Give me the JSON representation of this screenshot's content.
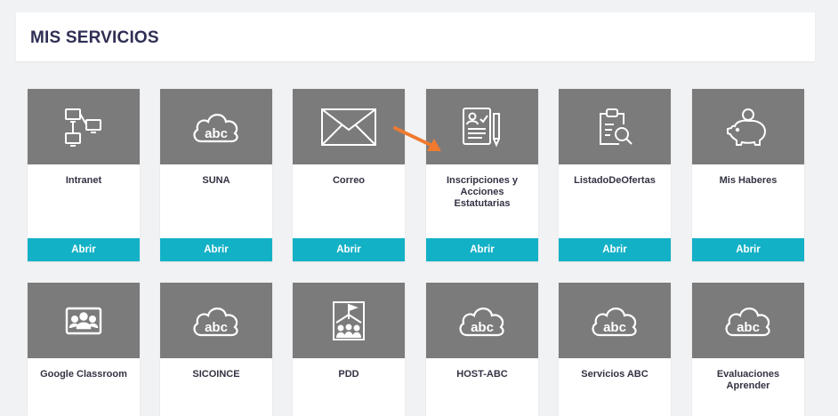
{
  "header": {
    "title": "MIS SERVICIOS"
  },
  "colors": {
    "accent": "#13b1c6",
    "tile": "#7b7b7b",
    "arrow": "#ef7a2e"
  },
  "cards": [
    {
      "label": "Intranet",
      "icon": "network-computers-icon",
      "button": "Abrir"
    },
    {
      "label": "SUNA",
      "icon": "abc-cloud-icon",
      "button": "Abrir"
    },
    {
      "label": "Correo",
      "icon": "envelope-icon",
      "button": "Abrir"
    },
    {
      "label": "Inscripciones y\nAcciones Estatutarias",
      "icon": "document-pen-icon",
      "button": "Abrir"
    },
    {
      "label": "ListadoDeOfertas",
      "icon": "clipboard-search-icon",
      "button": "Abrir"
    },
    {
      "label": "Mis Haberes",
      "icon": "piggy-bank-icon",
      "button": "Abrir"
    },
    {
      "label": "Google Classroom",
      "icon": "classroom-board-icon"
    },
    {
      "label": "SICOINCE",
      "icon": "abc-cloud-icon"
    },
    {
      "label": "PDD",
      "icon": "school-building-icon"
    },
    {
      "label": "HOST-ABC",
      "icon": "abc-cloud-icon"
    },
    {
      "label": "Servicios ABC",
      "icon": "abc-cloud-icon"
    },
    {
      "label": "Evaluaciones\nAprender",
      "icon": "abc-cloud-icon"
    }
  ]
}
